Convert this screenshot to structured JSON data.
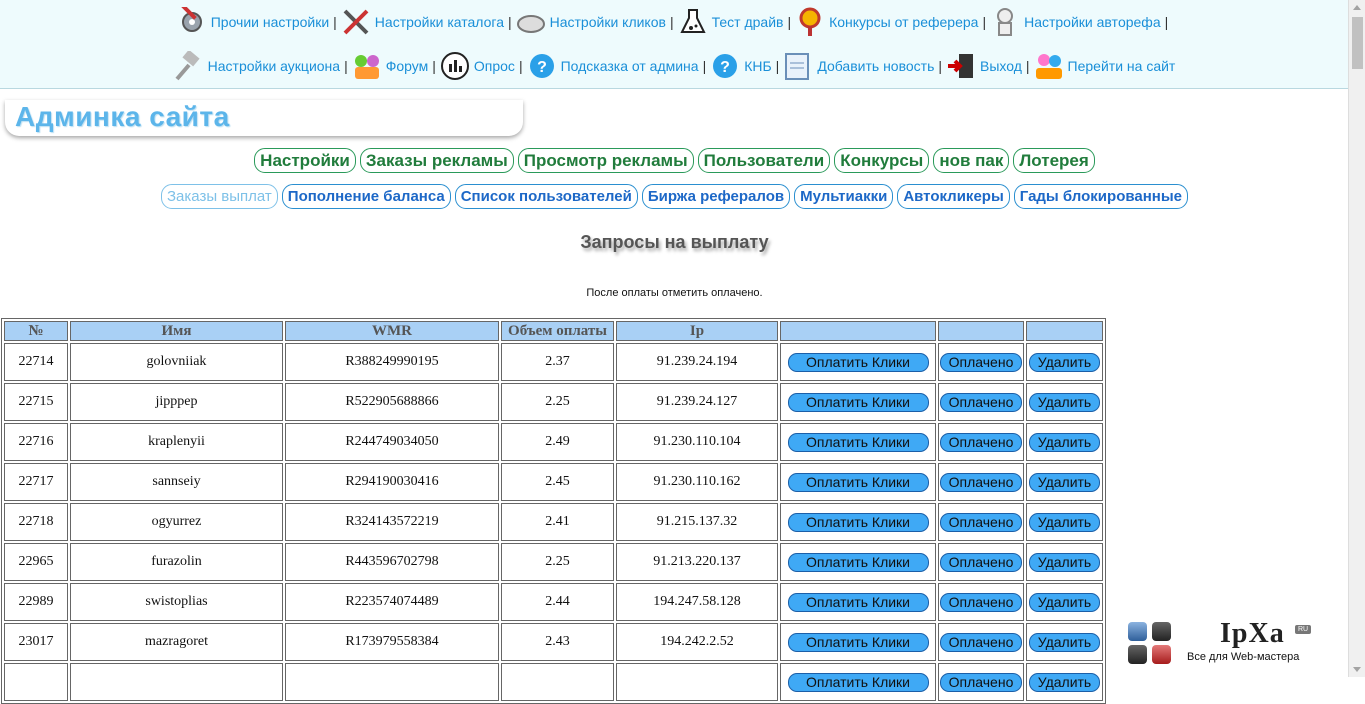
{
  "nav_row1": [
    {
      "label": "Прочии настройки",
      "icon": "tools-gear-icon"
    },
    {
      "label": "Настройки каталога",
      "icon": "hammer-wrench-icon"
    },
    {
      "label": "Настройки кликов",
      "icon": "mouse-icon"
    },
    {
      "label": "Тест драйв",
      "icon": "flask-icon"
    },
    {
      "label": "Конкурсы от реферера",
      "icon": "medal-icon"
    },
    {
      "label": "Настройки автoрефа",
      "icon": "robot-icon"
    }
  ],
  "nav_row2": [
    {
      "label": "Настройки аукциона",
      "icon": "gavel-icon"
    },
    {
      "label": "Форум",
      "icon": "forum-people-icon"
    },
    {
      "label": "Опрос",
      "icon": "poll-chart-icon"
    },
    {
      "label": "Подсказка от админа",
      "icon": "help-question-icon"
    },
    {
      "label": "КНБ",
      "icon": "help-question-icon"
    },
    {
      "label": "Добавить новость",
      "icon": "news-icon"
    },
    {
      "label": "Выход",
      "icon": "exit-door-icon"
    },
    {
      "label": "Перейти на сайт",
      "icon": "site-people-icon"
    }
  ],
  "site_title": "Админка сайта",
  "main_tabs": [
    "Настройки",
    "Заказы рекламы",
    "Просмотр рекламы",
    "Пользователи",
    "Конкурсы",
    "нов пак",
    "Лотерея"
  ],
  "sub_tabs": [
    "Заказы выплат",
    "Пополнение баланса",
    "Список пользователей",
    "Биржа рефералов",
    "Мультиакки",
    "Автокликеры",
    "Гады блокированные"
  ],
  "heading": "Запросы на выплату",
  "note": "После оплаты отметить оплачено.",
  "table": {
    "columns": [
      "№",
      "Имя",
      "WMR",
      "Объем оплаты",
      "Ip",
      "",
      "",
      ""
    ],
    "buttons": {
      "pay": "Оплатить Клики",
      "paid": "Оплачено",
      "delete": "Удалить"
    },
    "rows": [
      {
        "id": "22714",
        "name": "golovniiak",
        "wmr": "R388249990195",
        "amount": "2.37",
        "ip": "91.239.24.194"
      },
      {
        "id": "22715",
        "name": "jipppep",
        "wmr": "R522905688866",
        "amount": "2.25",
        "ip": "91.239.24.127"
      },
      {
        "id": "22716",
        "name": "kraplenyii",
        "wmr": "R244749034050",
        "amount": "2.49",
        "ip": "91.230.110.104"
      },
      {
        "id": "22717",
        "name": "sannseiy",
        "wmr": "R294190030416",
        "amount": "2.45",
        "ip": "91.230.110.162"
      },
      {
        "id": "22718",
        "name": "ogyurrez",
        "wmr": "R324143572219",
        "amount": "2.41",
        "ip": "91.215.137.32"
      },
      {
        "id": "22965",
        "name": "furazolin",
        "wmr": "R443596702798",
        "amount": "2.25",
        "ip": "91.213.220.137"
      },
      {
        "id": "22989",
        "name": "swistoplias",
        "wmr": "R223574074489",
        "amount": "2.44",
        "ip": "194.247.58.128"
      },
      {
        "id": "23017",
        "name": "mazragoret",
        "wmr": "R173979558384",
        "amount": "2.43",
        "ip": "194.242.2.52"
      }
    ]
  },
  "logo": {
    "name": "IpXa",
    "badge": "RU",
    "subtitle": "Все для Web-мастера"
  },
  "colors": {
    "link": "#1a8fd8",
    "header_bg": "#a9d0f5",
    "button": "#3fa9f5",
    "main_tab": "#217c3c",
    "sub_tab": "#1d68c7"
  }
}
